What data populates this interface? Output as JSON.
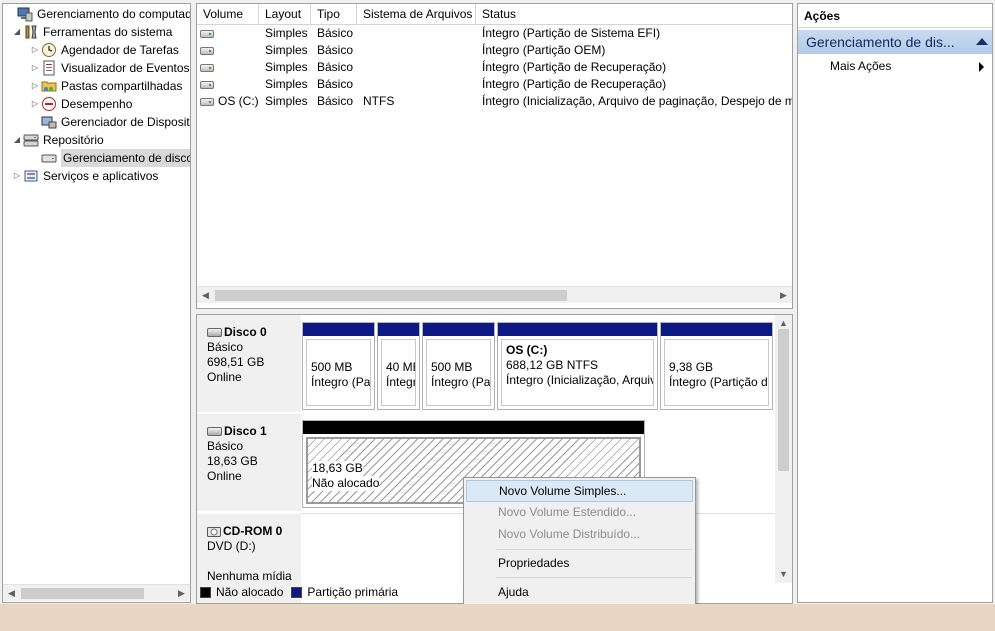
{
  "tree": {
    "items": [
      {
        "label": "Gerenciamento do computador (L",
        "icon": "computer-management-icon",
        "level": 0,
        "expander": ""
      },
      {
        "label": "Ferramentas do sistema",
        "icon": "system-tools-icon",
        "level": 1,
        "expander": "◢"
      },
      {
        "label": "Agendador de Tarefas",
        "icon": "task-scheduler-icon",
        "level": 2,
        "expander": "▷"
      },
      {
        "label": "Visualizador de Eventos",
        "icon": "event-viewer-icon",
        "level": 2,
        "expander": "▷"
      },
      {
        "label": "Pastas compartilhadas",
        "icon": "shared-folders-icon",
        "level": 2,
        "expander": "▷"
      },
      {
        "label": "Desempenho",
        "icon": "performance-icon",
        "level": 2,
        "expander": "▷"
      },
      {
        "label": "Gerenciador de Dispositivos",
        "icon": "device-manager-icon",
        "level": 2,
        "expander": ""
      },
      {
        "label": "Repositório",
        "icon": "storage-icon",
        "level": 1,
        "expander": "◢"
      },
      {
        "label": "Gerenciamento de disco",
        "icon": "disk-management-icon",
        "level": 2,
        "expander": ""
      },
      {
        "label": "Serviços e aplicativos",
        "icon": "services-apps-icon",
        "level": 1,
        "expander": "▷"
      }
    ]
  },
  "volume_list": {
    "columns": [
      "Volume",
      "Layout",
      "Tipo",
      "Sistema de Arquivos",
      "Status"
    ],
    "rows": [
      {
        "volume": "",
        "layout": "Simples",
        "tipo": "Básico",
        "fs": "",
        "status": "Íntegro (Partição de Sistema EFI)"
      },
      {
        "volume": "",
        "layout": "Simples",
        "tipo": "Básico",
        "fs": "",
        "status": "Íntegro (Partição OEM)"
      },
      {
        "volume": "",
        "layout": "Simples",
        "tipo": "Básico",
        "fs": "",
        "status": "Íntegro (Partição de Recuperação)"
      },
      {
        "volume": "",
        "layout": "Simples",
        "tipo": "Básico",
        "fs": "",
        "status": "Íntegro (Partição de Recuperação)"
      },
      {
        "volume": "OS (C:)",
        "layout": "Simples",
        "tipo": "Básico",
        "fs": "NTFS",
        "status": "Íntegro (Inicialização, Arquivo de paginação, Despejo de m"
      }
    ]
  },
  "disks": {
    "disk0": {
      "name": "Disco 0",
      "type": "Básico",
      "size": "698,51 GB",
      "state": "Online",
      "partitions": [
        {
          "title": "",
          "size": "500 MB",
          "status": "Íntegro (Pa"
        },
        {
          "title": "",
          "size": "40 MB",
          "status": "Íntegr"
        },
        {
          "title": "",
          "size": "500 MB",
          "status": "Íntegro (Pa"
        },
        {
          "title": "OS  (C:)",
          "size": "688,12 GB NTFS",
          "status": "Íntegro (Inicialização, Arquiv"
        },
        {
          "title": "",
          "size": "9,38 GB",
          "status": "Íntegro (Partição d"
        }
      ]
    },
    "disk1": {
      "name": "Disco 1",
      "type": "Básico",
      "size": "18,63 GB",
      "state": "Online",
      "partitions": [
        {
          "size": "18,63 GB",
          "status": "Não alocado"
        }
      ]
    },
    "cdrom0": {
      "name": "CD-ROM 0",
      "type": "DVD (D:)",
      "state": "Nenhuma mídia"
    }
  },
  "legend": {
    "unallocated": "Não alocado",
    "primary": "Partição primária",
    "unallocated_color": "#000000",
    "primary_color": "#0c1983"
  },
  "actions": {
    "header": "Ações",
    "section": "Gerenciamento de dis...",
    "more": "Mais Ações"
  },
  "context_menu": {
    "items": [
      {
        "label": "Novo Volume Simples...",
        "state": "highlighted"
      },
      {
        "label": "Novo Volume Estendido...",
        "state": "disabled"
      },
      {
        "label": "Novo Volume Distribuído...",
        "state": "disabled"
      },
      {
        "label": "Propriedades",
        "state": "normal"
      },
      {
        "label": "Ajuda",
        "state": "normal"
      }
    ]
  }
}
